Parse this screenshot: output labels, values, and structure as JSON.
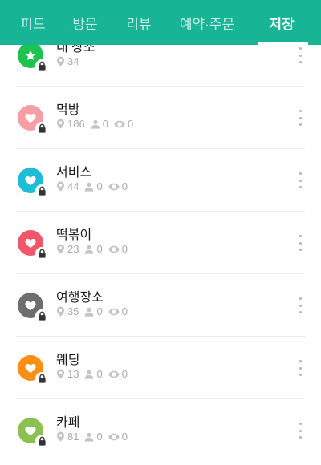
{
  "tabs": [
    {
      "label": "피드",
      "active": false
    },
    {
      "label": "방문",
      "active": false
    },
    {
      "label": "리뷰",
      "active": false
    },
    {
      "label": "예약·주문",
      "active": false
    },
    {
      "label": "저장",
      "active": true
    }
  ],
  "colors": {
    "header_bg": "#17b496",
    "text_primary": "#1a1a1a",
    "text_muted": "#aaaaaa"
  },
  "lists": [
    {
      "title": "내 장소",
      "icon": "star-icon",
      "color": "#1ec24f",
      "places": "34"
    },
    {
      "title": "먹방",
      "icon": "heart-icon",
      "color": "#f59ea6",
      "places": "186",
      "followers": "0",
      "views": "0"
    },
    {
      "title": "서비스",
      "icon": "heart-icon",
      "color": "#1fbcd6",
      "places": "44",
      "followers": "0",
      "views": "0"
    },
    {
      "title": "떡볶이",
      "icon": "heart-icon",
      "color": "#f25669",
      "places": "23",
      "followers": "0",
      "views": "0"
    },
    {
      "title": "여행장소",
      "icon": "heart-icon",
      "color": "#6e6e6e",
      "places": "35",
      "followers": "0",
      "views": "0"
    },
    {
      "title": "웨딩",
      "icon": "heart-icon",
      "color": "#fa8f14",
      "places": "13",
      "followers": "0",
      "views": "0"
    },
    {
      "title": "카페",
      "icon": "heart-icon",
      "color": "#8cc152",
      "places": "81",
      "followers": "0",
      "views": "0"
    }
  ]
}
